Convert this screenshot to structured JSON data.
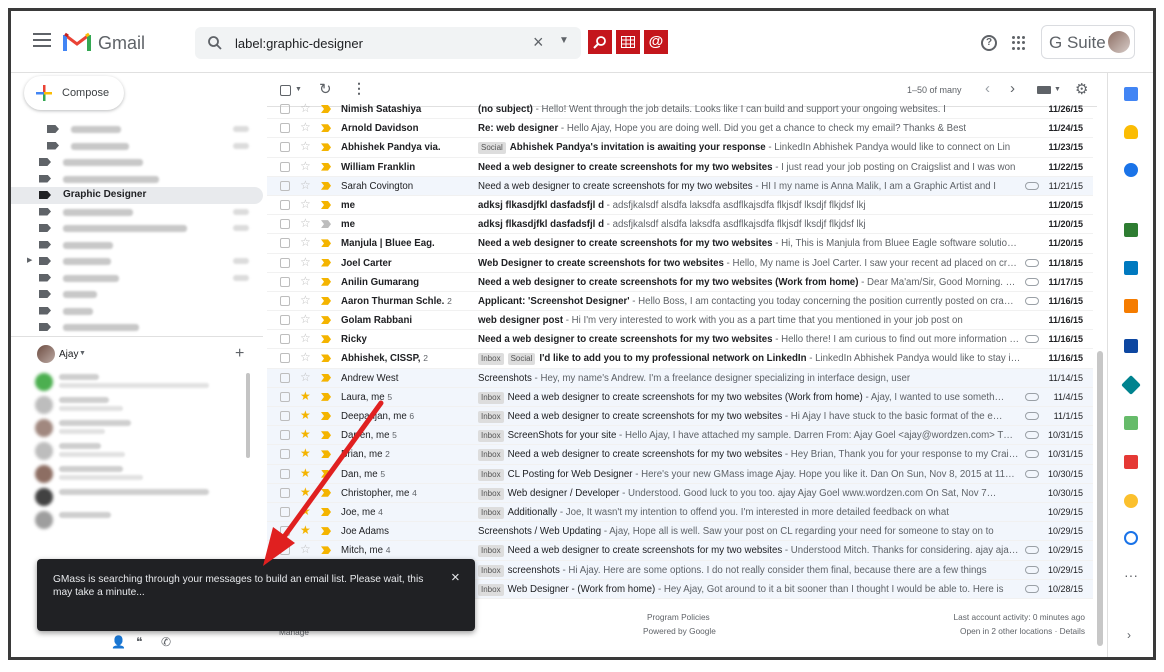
{
  "app": {
    "brand": "Gmail",
    "gsuite": "G Suite"
  },
  "search": {
    "value": "label:graphic-designer"
  },
  "gmass_buttons": [
    {
      "icon": "search-icon",
      "glyph": "⌕"
    },
    {
      "icon": "spreadsheet-icon",
      "glyph": "▦"
    },
    {
      "icon": "at-icon",
      "glyph": "@"
    }
  ],
  "compose": {
    "label": "Compose"
  },
  "sidebar": {
    "active_label": "Graphic Designer",
    "hangouts_user": "Ajay"
  },
  "toolbar": {
    "pager": "1–50 of many"
  },
  "emails": [
    {
      "sender": "Nimish Satashiya",
      "count": "",
      "subject": "(no subject)",
      "snippet": " - Hello! Went through the job details. Looks like I can build and support your ongoing websites. I",
      "date": "11/26/15",
      "unread": true,
      "star": false,
      "badges": [],
      "clip": false
    },
    {
      "sender": "Arnold Davidson",
      "count": "",
      "subject": "Re: web designer",
      "snippet": " - Hello Ajay, Hope you are doing well. Did you get a chance to check my email? Thanks & Best",
      "date": "11/24/15",
      "unread": true,
      "star": false,
      "badges": [],
      "clip": false
    },
    {
      "sender": "Abhishek Pandya via.",
      "count": "",
      "subject": "Abhishek Pandya's invitation is awaiting your response",
      "snippet": " - LinkedIn Abhishek Pandya would like to connect on Lin",
      "date": "11/23/15",
      "unread": true,
      "star": false,
      "badges": [
        "Social"
      ],
      "clip": false
    },
    {
      "sender": "William Franklin",
      "count": "",
      "subject": "Need a web designer to create screenshots for my two websites",
      "snippet": " - I just read your job posting on Craigslist and I was won",
      "date": "11/22/15",
      "unread": true,
      "star": false,
      "badges": [],
      "clip": false
    },
    {
      "sender": "Sarah Covington",
      "count": "",
      "subject": "Need a web designer to create screenshots for my two websites",
      "snippet": " - HI I my name is Anna Malik, I am a Graphic Artist and I",
      "date": "11/21/15",
      "unread": false,
      "star": false,
      "badges": [],
      "clip": true
    },
    {
      "sender": "me",
      "count": "",
      "subject": "adksj flkasdjfkl dasfadsfjl d",
      "snippet": " - adsfjkalsdf alsdfa laksdfa asdflkajsdfa flkjsdf lksdjf flkjdsf lkj",
      "date": "11/20/15",
      "unread": true,
      "star": false,
      "badges": [],
      "clip": false
    },
    {
      "sender": "me",
      "count": "",
      "subject": "adksj flkasdjfkl dasfadsfjl d",
      "snippet": " - adsfjkalsdf alsdfa laksdfa asdflkajsdfa flkjsdf lksdjf flkjdsf lkj",
      "date": "11/20/15",
      "unread": true,
      "star": false,
      "badges": [],
      "clip": false,
      "imp_off": true
    },
    {
      "sender": "Manjula | Bluee Eag.",
      "count": "",
      "subject": "Need a web designer to create screenshots for my two websites",
      "snippet": " - Hi, This is Manjula from Bluee Eagle software solution…",
      "date": "11/20/15",
      "unread": true,
      "star": false,
      "badges": [],
      "clip": false
    },
    {
      "sender": "Joel Carter",
      "count": "",
      "subject": "Web Designer to create screenshots for two websites",
      "snippet": " - Hello, My name is Joel Carter. I saw your recent ad placed on crai…",
      "date": "11/18/15",
      "unread": true,
      "star": false,
      "badges": [],
      "clip": true
    },
    {
      "sender": "Anilin Gumarang",
      "count": "",
      "subject": "Need a web designer to create screenshots for my two websites (Work from home)",
      "snippet": " - Dear Ma'am/Sir, Good Morning. We…",
      "date": "11/17/15",
      "unread": true,
      "star": false,
      "badges": [],
      "clip": true
    },
    {
      "sender": "Aaron Thurman Schle.",
      "count": "2",
      "subject": "Applicant: 'Screenshot Designer'",
      "snippet": " - Hello Boss, I am contacting you today concerning the position currently posted on cra…",
      "date": "11/16/15",
      "unread": true,
      "star": false,
      "badges": [],
      "clip": true
    },
    {
      "sender": "Golam Rabbani",
      "count": "",
      "subject": "web designer post",
      "snippet": " - Hi I'm very interested to work with you as a part time that you mentioned in your job post on",
      "date": "11/16/15",
      "unread": true,
      "star": false,
      "badges": [],
      "clip": false
    },
    {
      "sender": "Ricky",
      "count": "",
      "subject": "Need a web designer to create screenshots for my two websites",
      "snippet": " - Hello there! I am curious to find out more information …",
      "date": "11/16/15",
      "unread": true,
      "star": false,
      "badges": [],
      "clip": true
    },
    {
      "sender": "Abhishek, CISSP,",
      "count": "2",
      "subject": "I'd like to add you to my professional network on LinkedIn",
      "snippet": " - LinkedIn Abhishek Pandya would like to stay in…",
      "date": "11/16/15",
      "unread": true,
      "star": false,
      "badges": [
        "Inbox",
        "Social"
      ],
      "clip": false
    },
    {
      "sender": "Andrew West",
      "count": "",
      "subject": "Screenshots",
      "snippet": " - Hey, my name's Andrew. I'm a freelance designer specializing in interface design, user",
      "date": "11/14/15",
      "unread": false,
      "star": false,
      "badges": [],
      "clip": false
    },
    {
      "sender": "Laura, me",
      "count": "5",
      "subject": "Need a web designer to create screenshots for my two websites (Work from home)",
      "snippet": " - Ajay, I wanted to use someth…",
      "date": "11/4/15",
      "unread": false,
      "star": true,
      "badges": [
        "Inbox"
      ],
      "clip": true
    },
    {
      "sender": "Deepanjan, me",
      "count": "6",
      "subject": "Need a web designer to create screenshots for my two websites",
      "snippet": " - Hi Ajay I have stuck to the basic format of the e…",
      "date": "11/1/15",
      "unread": false,
      "star": true,
      "badges": [
        "Inbox"
      ],
      "clip": true
    },
    {
      "sender": "Darren, me",
      "count": "5",
      "subject": "ScreenShots for your site",
      "snippet": " - Hello Ajay, I have attached my sample. Darren From: Ajay Goel <ajay@wordzen.com> T…",
      "date": "10/31/15",
      "unread": false,
      "star": true,
      "badges": [
        "Inbox"
      ],
      "clip": true
    },
    {
      "sender": "Brian, me",
      "count": "2",
      "subject": "Need a web designer to create screenshots for my two websites",
      "snippet": " - Hey Brian, Thank you for your response to my Craigsli…",
      "date": "10/31/15",
      "unread": false,
      "star": true,
      "badges": [
        "Inbox"
      ],
      "clip": true
    },
    {
      "sender": "Dan, me",
      "count": "5",
      "subject": "CL Posting for Web Designer",
      "snippet": " - Here's your new GMass image Ajay. Hope you like it. Dan On Sun, Nov 8, 2015 at 11…",
      "date": "10/30/15",
      "unread": false,
      "star": true,
      "badges": [
        "Inbox"
      ],
      "clip": true
    },
    {
      "sender": "Christopher, me",
      "count": "4",
      "subject": "Web designer / Developer",
      "snippet": " - Understood. Good luck to you too. ajay Ajay Goel www.wordzen.com On Sat, Nov 7…",
      "date": "10/30/15",
      "unread": false,
      "star": true,
      "badges": [
        "Inbox"
      ],
      "clip": false
    },
    {
      "sender": "Joe, me",
      "count": "4",
      "subject": "Additionally",
      "snippet": " - Joe, It wasn't my intention to offend you. I'm interested in more detailed feedback on what",
      "date": "10/29/15",
      "unread": false,
      "star": true,
      "badges": [
        "Inbox"
      ],
      "clip": false
    },
    {
      "sender": "Joe Adams",
      "count": "",
      "subject": "Screenshots / Web Updating",
      "snippet": " - Ajay, Hope all is well. Saw your post on CL regarding your need for someone to stay on to",
      "date": "10/29/15",
      "unread": false,
      "star": true,
      "badges": [],
      "clip": false
    },
    {
      "sender": "Mitch, me",
      "count": "4",
      "subject": "Need a web designer to create screenshots for my two websites",
      "snippet": " - Understood Mitch. Thanks for considering. ajay ajay…",
      "date": "10/29/15",
      "unread": false,
      "star": false,
      "badges": [
        "Inbox"
      ],
      "clip": true
    },
    {
      "sender": "",
      "count": "",
      "subject": "screenshots",
      "snippet": " - Hi Ajay. Here are some options. I do not really consider them final, because there are a few things",
      "date": "10/29/15",
      "unread": false,
      "star": false,
      "badges": [
        "Inbox"
      ],
      "clip": true
    },
    {
      "sender": "",
      "count": "",
      "subject": "Web Designer - (Work from home)",
      "snippet": " - Hey Ajay, Got around to it a bit sooner than I thought I would be able to. Here is",
      "date": "10/28/15",
      "unread": false,
      "star": false,
      "badges": [
        "Inbox"
      ],
      "clip": true
    }
  ],
  "footer": {
    "manage": "Manage",
    "program_policies": "Program Policies",
    "powered_by": "Powered by Google",
    "last_activity": "Last account activity: 0 minutes ago",
    "open_locations": "Open in 2 other locations · Details"
  },
  "toast": {
    "message": "GMass is searching through your messages to build an email list. Please wait, this may take a minute..."
  },
  "colors": {
    "accent_red": "#c4161c",
    "star": "#f4b400",
    "toast_bg": "#202124"
  }
}
